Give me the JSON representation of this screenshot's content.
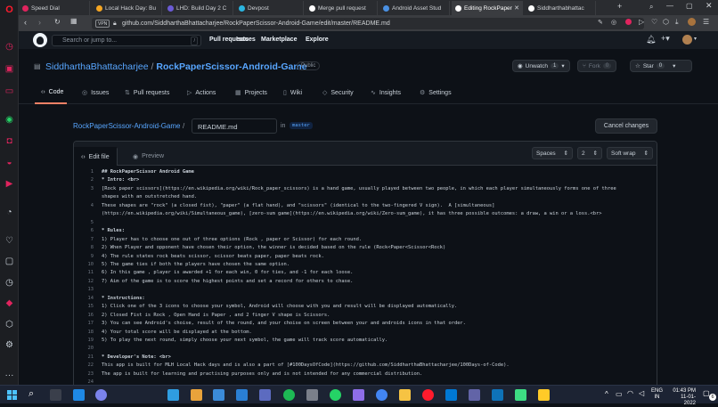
{
  "browser": {
    "tabs": [
      {
        "label": "Speed Dial",
        "color": "#e0245e",
        "active": false
      },
      {
        "label": "Local Hack Day: Bu",
        "color": "#f5a623",
        "active": false
      },
      {
        "label": "LHD: Build Day 2 C",
        "color": "#6b5bd6",
        "active": false
      },
      {
        "label": "Devpost",
        "color": "#2bb5e0",
        "active": false
      },
      {
        "label": "Merge pull request",
        "color": "#ffffff",
        "active": false
      },
      {
        "label": "Android Asset Stud",
        "color": "#4a90e2",
        "active": false
      },
      {
        "label": "Editing RockPaper",
        "color": "#ffffff",
        "active": true
      },
      {
        "label": "Siddharthabhattac",
        "color": "#ffffff",
        "active": false
      }
    ],
    "vpn_label": "VPN",
    "url": "github.com/SiddharthaBhattacharjee/RockPaperScissor-Android-Game/edit/master/README.md"
  },
  "gh_header": {
    "search_placeholder": "Search or jump to...",
    "search_shortcut": "/",
    "nav": [
      "Pull requests",
      "Issues",
      "Marketplace",
      "Explore"
    ]
  },
  "repo": {
    "owner": "SiddharthaBhattacharjee",
    "separator": "/",
    "name": "RockPaperScissor-Android-Game",
    "visibility": "Public",
    "unwatch_label": "Unwatch",
    "unwatch_count": "1",
    "fork_label": "Fork",
    "fork_count": "0",
    "star_label": "Star",
    "star_count": "0",
    "tabs": [
      {
        "label": "Code",
        "icon": "code-icon",
        "active": true
      },
      {
        "label": "Issues",
        "icon": "issue-icon",
        "active": false
      },
      {
        "label": "Pull requests",
        "icon": "pr-icon",
        "active": false
      },
      {
        "label": "Actions",
        "icon": "play-icon",
        "active": false
      },
      {
        "label": "Projects",
        "icon": "table-icon",
        "active": false
      },
      {
        "label": "Wiki",
        "icon": "book-icon",
        "active": false
      },
      {
        "label": "Security",
        "icon": "shield-icon",
        "active": false
      },
      {
        "label": "Insights",
        "icon": "graph-icon",
        "active": false
      },
      {
        "label": "Settings",
        "icon": "gear-icon",
        "active": false
      }
    ]
  },
  "edit": {
    "breadcrumb_repo": "RockPaperScissor-Android-Game",
    "breadcrumb_sep": "/",
    "filename": "README.md",
    "in_label": "in",
    "branch": "master",
    "cancel_label": "Cancel changes",
    "tab_edit": "Edit file",
    "tab_preview": "Preview",
    "indent_mode": "Spaces",
    "indent_size": "2",
    "wrap_mode": "Soft wrap"
  },
  "code_lines": [
    {
      "n": "1",
      "t": "## RockPaperScissor Android Game"
    },
    {
      "n": "2",
      "t": "* Intro: <br>"
    },
    {
      "n": "3",
      "t": "[Rock paper scissors](https://en.wikipedia.org/wiki/Rock_paper_scissors) is a hand game, usually played between two people, in which each player simultaneously forms one of three"
    },
    {
      "n": "",
      "t": "shapes with an outstretched hand."
    },
    {
      "n": "4",
      "t": "These shapes are \"rock\" (a closed fist), \"paper\" (a flat hand), and \"scissors\" (identical to the two-fingered V sign).  A [simultaneous]"
    },
    {
      "n": "",
      "t": "(https://en.wikipedia.org/wiki/Simultaneous_game), [zero-sum game](https://en.wikipedia.org/wiki/Zero-sum_game), it has three possible outcomes: a draw, a win or a loss.<br>"
    },
    {
      "n": "5",
      "t": ""
    },
    {
      "n": "6",
      "t": "* Rules:"
    },
    {
      "n": "7",
      "t": "1) Player has to choose one out of three options (Rock , paper or Scissor) for each round."
    },
    {
      "n": "8",
      "t": "2) When Player and opponent have chosen their option, the winner is decided based on the rule (Rock<Paper<Scissor<Rock)"
    },
    {
      "n": "9",
      "t": "4) The rule states rock beats scissor, scissor beats paper, paper beats rock."
    },
    {
      "n": "10",
      "t": "5) The game ties if both the players have chosen the same option."
    },
    {
      "n": "11",
      "t": "6) In this game , player is awarded +1 for each win, 0 for ties, and -1 for each loose."
    },
    {
      "n": "12",
      "t": "7) Aim of the game is to score the highest points and set a record for others to chase."
    },
    {
      "n": "13",
      "t": ""
    },
    {
      "n": "14",
      "t": "* Instructions:"
    },
    {
      "n": "15",
      "t": "1) Click one of the 3 icons to choose your symbol, Android will choose with you and result will be displayed automatically."
    },
    {
      "n": "16",
      "t": "2) Closed Fist is Rock , Open Hand is Paper , and 2 finger V shape is Scissors."
    },
    {
      "n": "17",
      "t": "3) You can see Android's choise, result of the round, and your choise on screen between your and androids icons in that order."
    },
    {
      "n": "18",
      "t": "4) Your total score will be displayed at the bottom."
    },
    {
      "n": "19",
      "t": "5) To play the next round, simply choose your next symbol, the game will track score automatically."
    },
    {
      "n": "20",
      "t": ""
    },
    {
      "n": "21",
      "t": "* Developer's Note: <br>"
    },
    {
      "n": "22",
      "t": "This app is built for MLH Local Hack days and is also a part of [#100DaysOfCode](https://github.com/SiddharthaBhattacharjee/100Days-of-Code)."
    },
    {
      "n": "23",
      "t": "The app is built for learning and practising purposes only and is not intended for any commercial distribution."
    },
    {
      "n": "24",
      "t": ""
    }
  ],
  "taskbar": {
    "lang": "ENG",
    "region": "IN",
    "time": "01:43 PM",
    "date": "11-01-2022",
    "notif": "6"
  },
  "colors": {
    "link": "#58a6ff",
    "accent_underline": "#f78166",
    "opera_red": "#e0245e"
  }
}
